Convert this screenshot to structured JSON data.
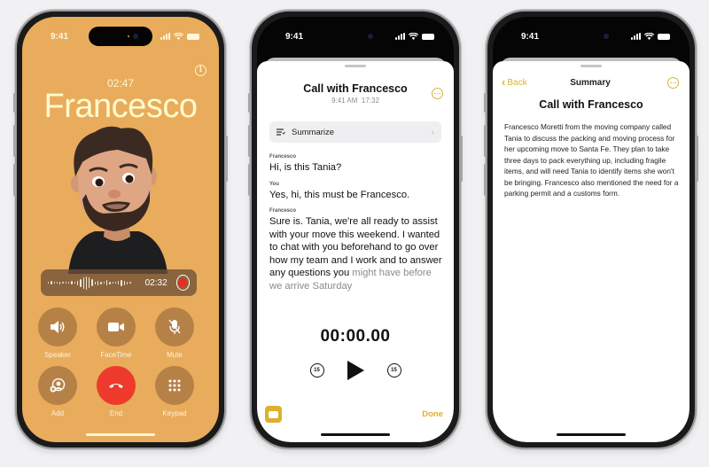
{
  "status_bar": {
    "time": "9:41"
  },
  "call_screen": {
    "elapsed": "02:47",
    "caller_name": "Francesco",
    "info_icon": "info-icon",
    "recording": {
      "time": "02:32",
      "icon": "record-stop-icon"
    },
    "controls": [
      {
        "label": "Speaker",
        "icon": "speaker-icon"
      },
      {
        "label": "FaceTime",
        "icon": "video-camera-icon"
      },
      {
        "label": "Mute",
        "icon": "mic-slash-icon"
      },
      {
        "label": "Add",
        "icon": "add-person-icon"
      },
      {
        "label": "End",
        "icon": "phone-end-icon"
      },
      {
        "label": "Keypad",
        "icon": "keypad-icon"
      }
    ]
  },
  "transcript_screen": {
    "title": "Call with Francesco",
    "date": "9:41 AM",
    "duration": "17:32",
    "summarize_label": "Summarize",
    "entries": [
      {
        "speaker": "Francesco",
        "text": "Hi, is this Tania?"
      },
      {
        "speaker": "You",
        "text": "Yes, hi, this must be Francesco."
      },
      {
        "speaker": "Francesco",
        "text": "Sure is. Tania, we're all ready to assist with your move this weekend. I wanted to chat with you beforehand to go over how my team and I work and to answer any questions you",
        "fade_text": "might have before we arrive Saturday"
      }
    ],
    "playback_time": "00:00.00",
    "skip_back": "15",
    "skip_forward": "15",
    "done_label": "Done"
  },
  "summary_screen": {
    "back_label": "Back",
    "nav_title": "Summary",
    "title": "Call with Francesco",
    "body": "Francesco Moretti from the moving company called Tania to discuss the packing and moving process for her upcoming move to Santa Fe. They plan to take three days to pack everything up, including fragile items, and will need Tania to identify items she won't be bringing. Francesco also mentioned the need for a parking permit and a customs form."
  },
  "colors": {
    "call_background": "#e9ac5c",
    "caller_name": "#fffacc",
    "end_call": "#ee3a2c",
    "accent_yellow": "#dfb02e",
    "record_red": "#ee2a24"
  }
}
